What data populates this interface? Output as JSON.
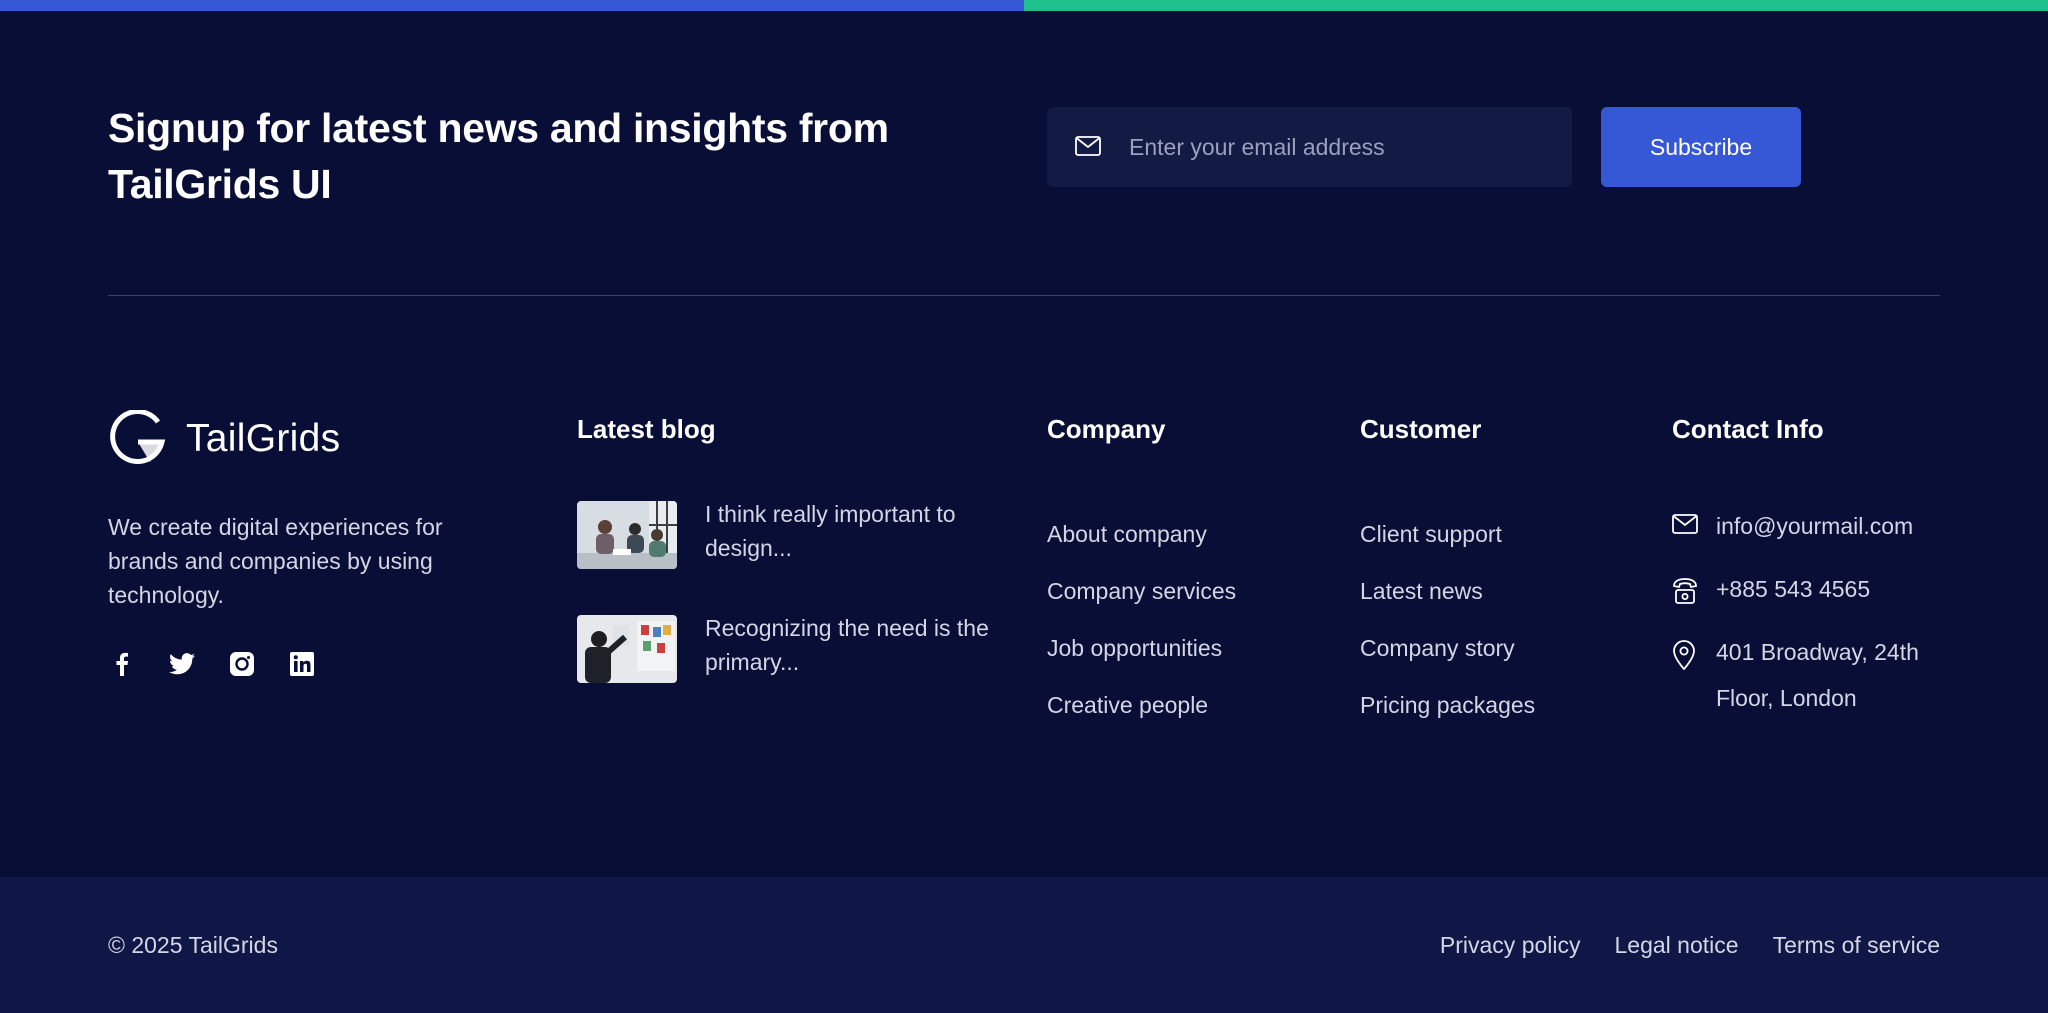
{
  "signup": {
    "title": "Signup for latest news and insights from TailGrids UI",
    "email_placeholder": "Enter your email address",
    "subscribe_label": "Subscribe"
  },
  "brand": {
    "name": "TailGrids",
    "description": "We create digital experiences for brands and companies by using technology.",
    "socials": [
      "facebook-icon",
      "twitter-icon",
      "instagram-icon",
      "linkedin-icon"
    ]
  },
  "blog": {
    "title": "Latest blog",
    "posts": [
      {
        "text": "I think really important to design..."
      },
      {
        "text": "Recognizing the need is the primary..."
      }
    ]
  },
  "company": {
    "title": "Company",
    "links": [
      "About company",
      "Company services",
      "Job opportunities",
      "Creative people"
    ]
  },
  "customer": {
    "title": "Customer",
    "links": [
      "Client support",
      "Latest news",
      "Company story",
      "Pricing packages"
    ]
  },
  "contact": {
    "title": "Contact Info",
    "email": "info@yourmail.com",
    "phone": "+885 543 4565",
    "address": "401 Broadway, 24th Floor, London"
  },
  "footer": {
    "copyright": "© 2025 TailGrids",
    "links": [
      "Privacy policy",
      "Legal notice",
      "Terms of service"
    ]
  },
  "colors": {
    "background": "#080e36",
    "accent_blue": "#3758d6",
    "accent_green": "#1ec08c",
    "bottom_bar": "#101645"
  }
}
